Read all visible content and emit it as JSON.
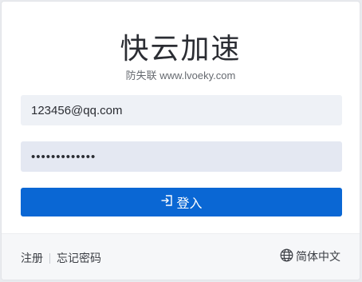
{
  "header": {
    "title": "快云加速",
    "subtitle": "防失联 www.lvoeky.com"
  },
  "form": {
    "email_value": "123456@qq.com",
    "password_value": "1234567890123",
    "login_label": "登入"
  },
  "footer": {
    "register_label": "注册",
    "forgot_label": "忘记密码",
    "language_label": "简体中文"
  },
  "colors": {
    "primary": "#0a67d4",
    "input_bg": "#eef1f6"
  },
  "icons": {
    "login": "login-icon",
    "language": "globe-icon"
  }
}
